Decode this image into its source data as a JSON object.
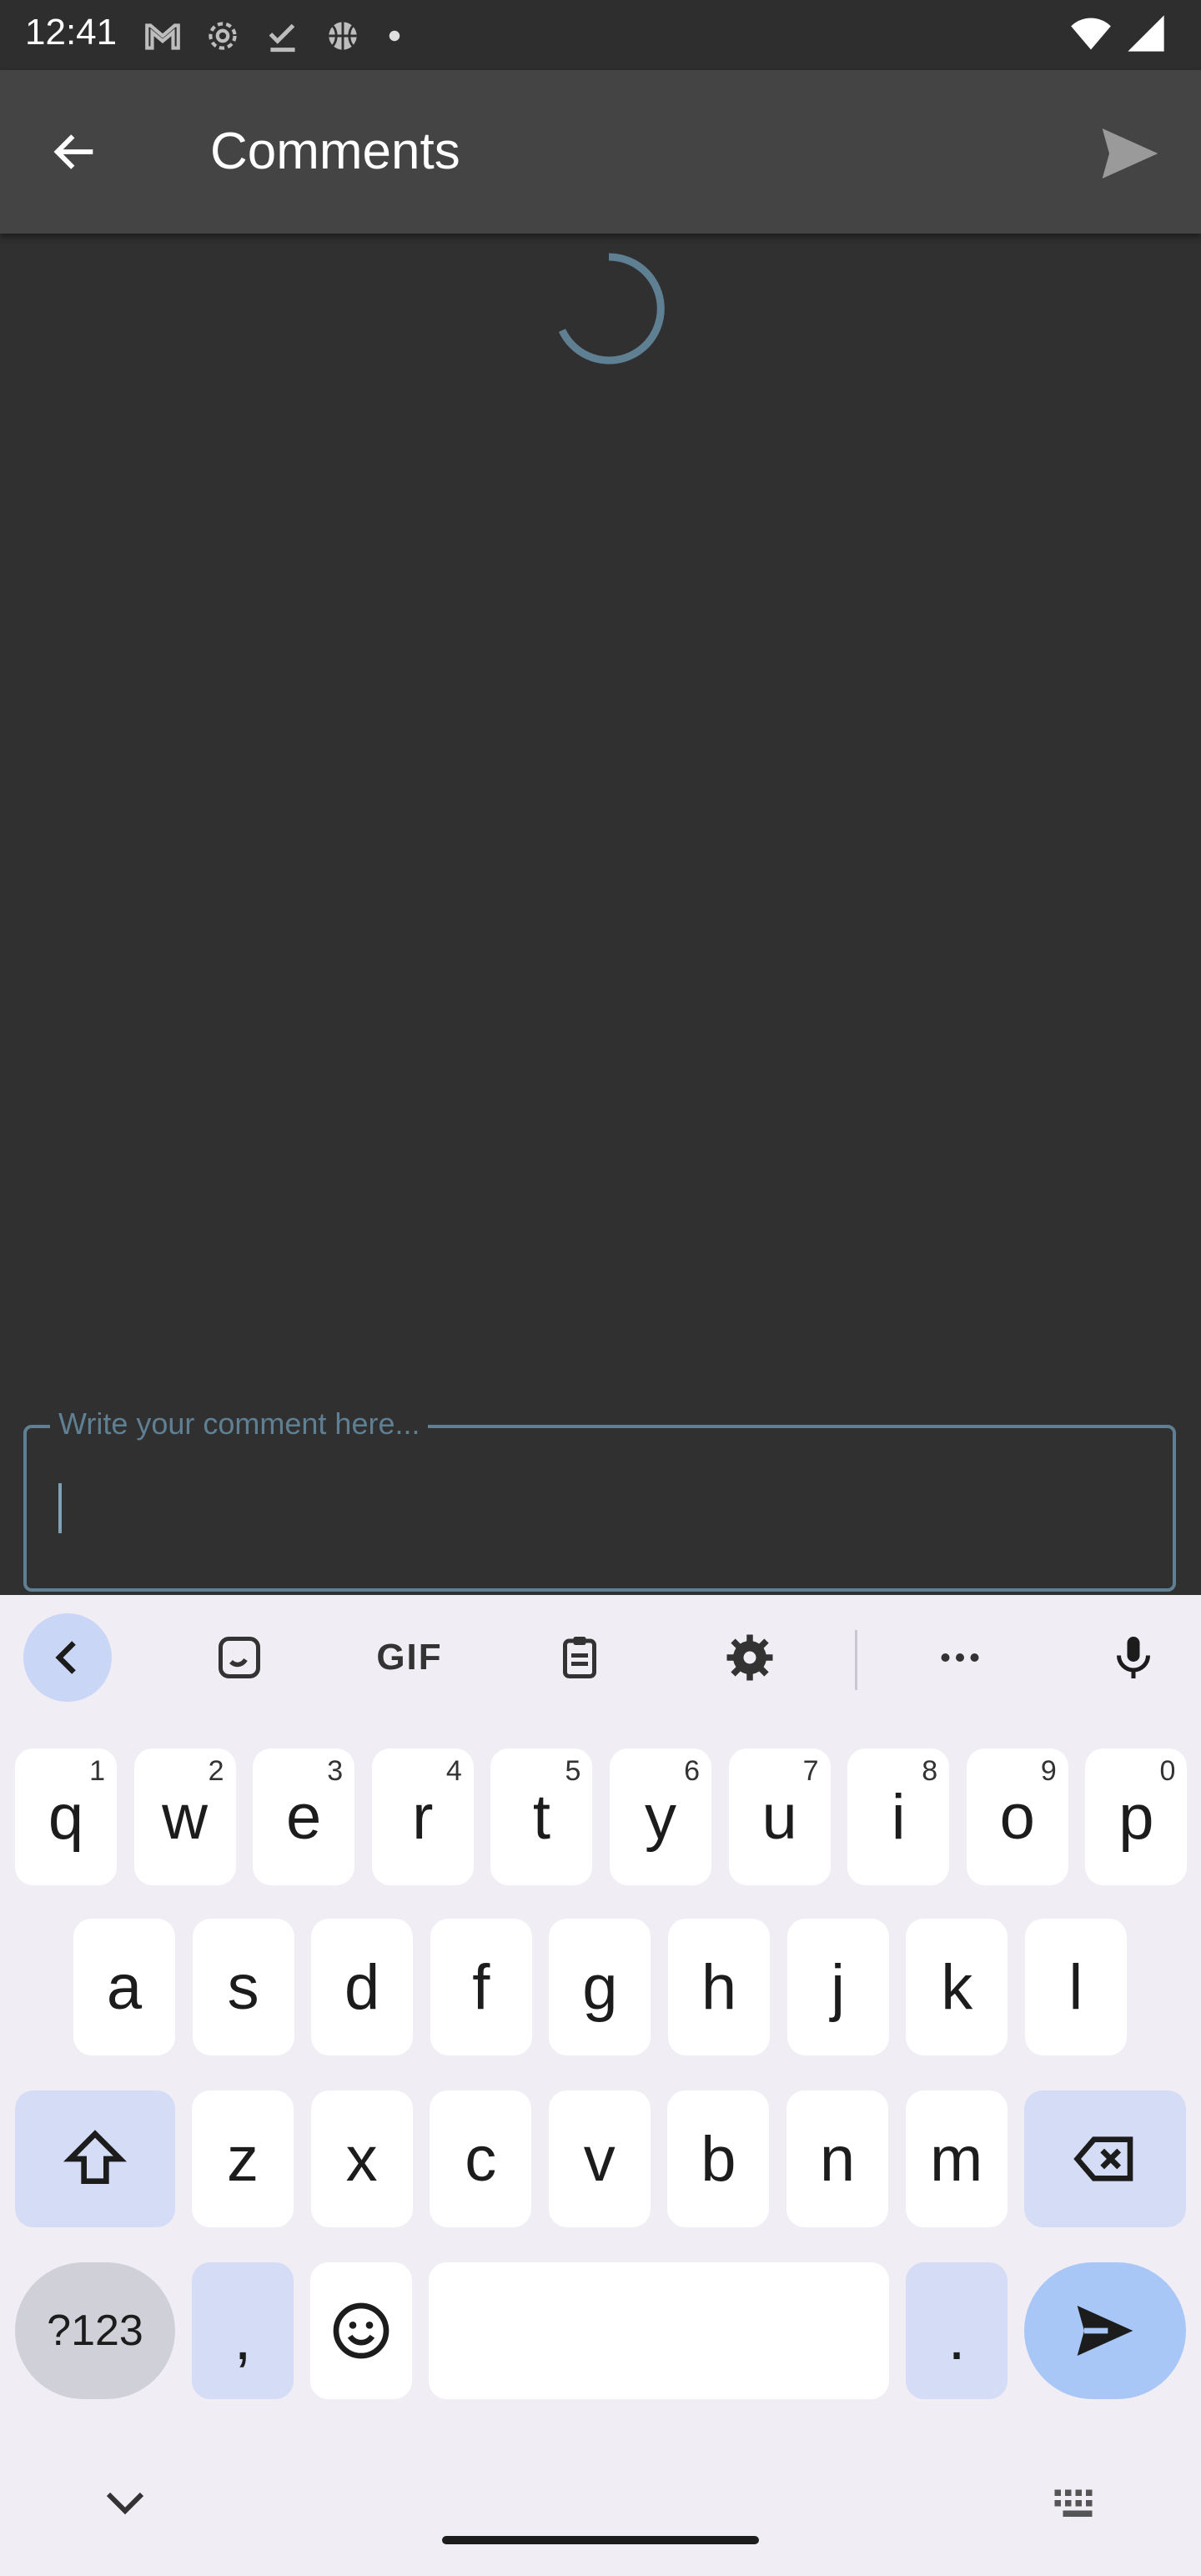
{
  "status_bar": {
    "time": "12:41",
    "icons": [
      "gmail-icon",
      "settings-gear-icon",
      "download-done-icon",
      "basketball-icon",
      "dot-icon"
    ],
    "right_icons": [
      "wifi-icon",
      "signal-icon"
    ]
  },
  "app_bar": {
    "title": "Comments",
    "back_icon": "arrow-left-icon",
    "send_icon": "send-icon"
  },
  "comment_field": {
    "label": "Write your comment here...",
    "value": ""
  },
  "keyboard": {
    "toolbar": [
      "chevron-left-icon",
      "sticker-icon",
      "gif",
      "clipboard-icon",
      "settings-icon",
      "more-icon",
      "mic-icon"
    ],
    "gif_label": "GIF",
    "row1": [
      {
        "k": "q",
        "h": "1"
      },
      {
        "k": "w",
        "h": "2"
      },
      {
        "k": "e",
        "h": "3"
      },
      {
        "k": "r",
        "h": "4"
      },
      {
        "k": "t",
        "h": "5"
      },
      {
        "k": "y",
        "h": "6"
      },
      {
        "k": "u",
        "h": "7"
      },
      {
        "k": "i",
        "h": "8"
      },
      {
        "k": "o",
        "h": "9"
      },
      {
        "k": "p",
        "h": "0"
      }
    ],
    "row2": [
      "a",
      "s",
      "d",
      "f",
      "g",
      "h",
      "j",
      "k",
      "l"
    ],
    "row3": [
      "z",
      "x",
      "c",
      "v",
      "b",
      "n",
      "m"
    ],
    "sym_label": "?123",
    "comma": ",",
    "period": "."
  },
  "colors": {
    "accent": "#5f7f93",
    "app_bar": "#444444",
    "background": "#303030",
    "keyboard_bg": "#f0eef4",
    "key_alt": "#d4dcf6",
    "key_send": "#a8c6f6"
  }
}
